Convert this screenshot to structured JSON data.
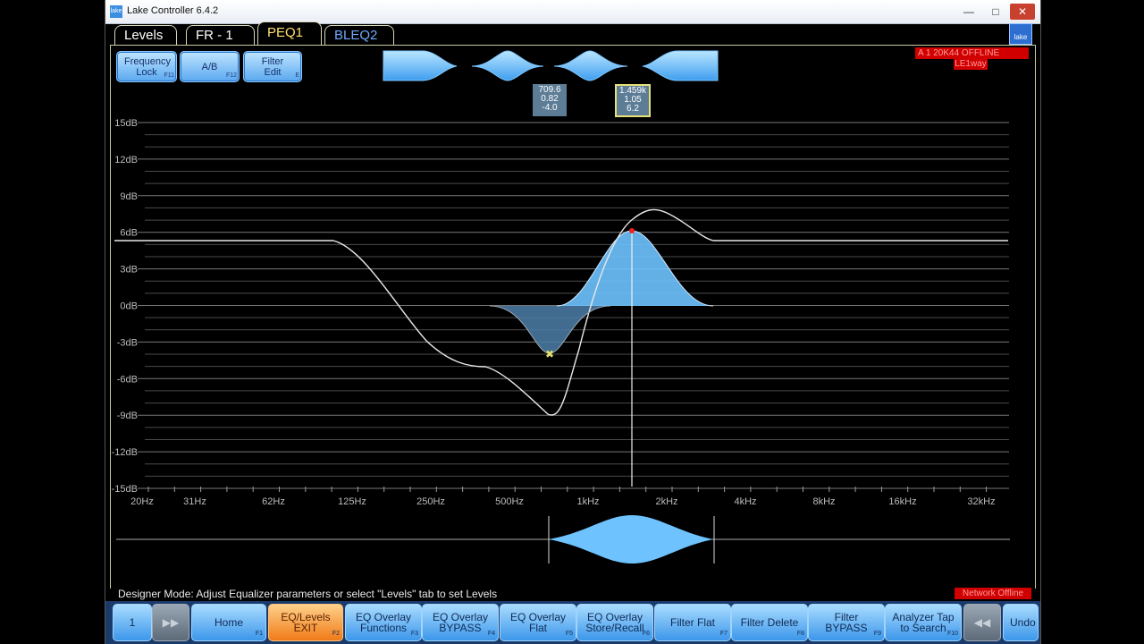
{
  "window": {
    "title": "Lake Controller 6.4.2",
    "min": "—",
    "max": "□",
    "close": "✕"
  },
  "tabs": [
    {
      "label": "Levels"
    },
    {
      "label": "FR - 1"
    },
    {
      "label": "PEQ1"
    },
    {
      "label": "BLEQ2"
    }
  ],
  "toolbar": {
    "freq_lock": {
      "label": "Frequency Lock",
      "key": "F11"
    },
    "ab": {
      "label": "A/B",
      "key": "F12"
    },
    "filter_edit": {
      "label": "Filter Edit",
      "key": "E"
    }
  },
  "logo": "lake",
  "status_top": {
    "line1": "A  1  20K44  OFFLINE",
    "line2": "LE1way"
  },
  "inspectors": [
    {
      "freq": "709.6",
      "q": "0.82",
      "gain": "-4.0"
    },
    {
      "freq": "1.459k",
      "q": "1.05",
      "gain": "6.2"
    }
  ],
  "y_axis": [
    "15dB",
    "12dB",
    "9dB",
    "6dB",
    "3dB",
    "0dB",
    "-3dB",
    "-6dB",
    "-9dB",
    "-12dB",
    "-15dB"
  ],
  "x_axis": [
    "20Hz",
    "31Hz",
    "62Hz",
    "125Hz",
    "250Hz",
    "500Hz",
    "1kHz",
    "2kHz",
    "4kHz",
    "8kHz",
    "16kHz",
    "32kHz"
  ],
  "status_bar": {
    "message": "Designer Mode: Adjust Equalizer parameters or select \"Levels\" tab to set Levels",
    "network": "Network Offline"
  },
  "function_bar": [
    {
      "label": "1",
      "key": ""
    },
    {
      "label": "▶▶",
      "key": ""
    },
    {
      "label": "Home",
      "key": "F1"
    },
    {
      "label": "EQ/Levels EXIT",
      "key": "F2"
    },
    {
      "label": "EQ Overlay Functions",
      "key": "F3"
    },
    {
      "label": "EQ Overlay BYPASS",
      "key": "F4"
    },
    {
      "label": "EQ Overlay Flat",
      "key": "F5"
    },
    {
      "label": "EQ Overlay Store/Recall",
      "key": "F6"
    },
    {
      "label": "Filter Flat",
      "key": "F7"
    },
    {
      "label": "Filter Delete",
      "key": "F8"
    },
    {
      "label": "Filter BYPASS",
      "key": "F9"
    },
    {
      "label": "Analyzer Tap to Search",
      "key": "F10"
    },
    {
      "label": "◀◀",
      "key": ""
    },
    {
      "label": "Undo",
      "key": ""
    }
  ],
  "colors": {
    "accent": "#5aa8f0",
    "fill": "#6ec3ff",
    "selected": "#f07b18",
    "alert": "#d00000"
  }
}
